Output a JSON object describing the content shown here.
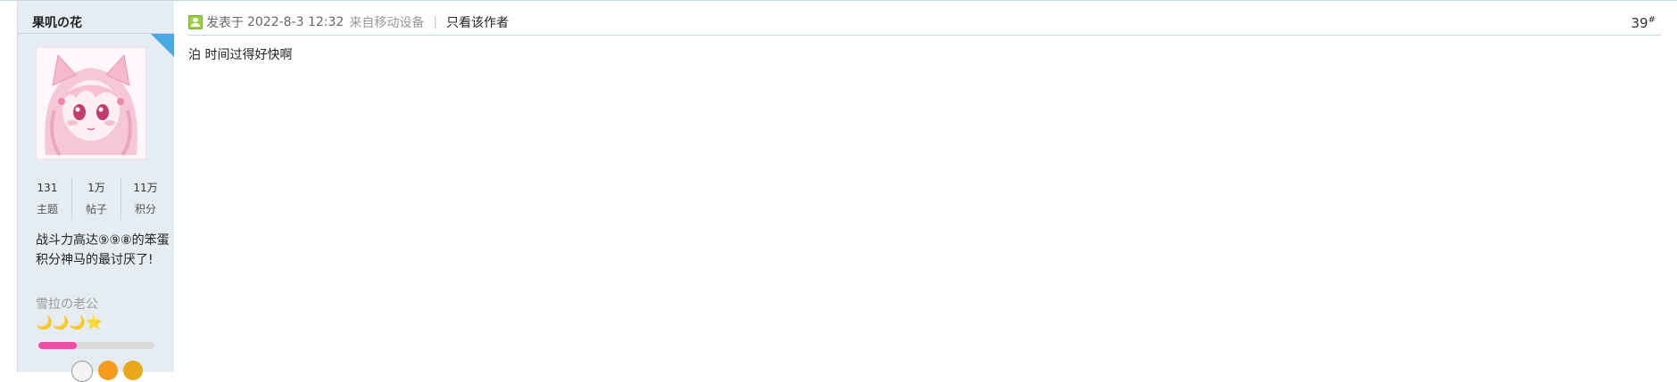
{
  "author": {
    "username": "果叽の花",
    "avatar_icon": "anime-avatar-icon",
    "stats": [
      {
        "value": "131",
        "label": "主题"
      },
      {
        "value": "1万",
        "label": "帖子"
      },
      {
        "value": "11万",
        "label": "积分"
      }
    ],
    "signature": "战斗力高达⑨⑨⑧的笨蛋积分神马的最讨厌了!",
    "group_title": "雪拉の老公",
    "rank_icons": "🌙🌙🌙⭐",
    "level_progress": 0.33,
    "colors": {
      "progress_fill": "#ec4fa3",
      "progress_track": "#d9d9d9",
      "sidebar_bg": "#e5edf2"
    }
  },
  "post": {
    "prefix": "发表于",
    "date": "2022-8-3 12:32",
    "device": "来自移动设备",
    "separator": "|",
    "author_only": "只看该作者",
    "floor_number": "39",
    "floor_suffix": "#",
    "body": "泊  时间过得好快啊"
  }
}
